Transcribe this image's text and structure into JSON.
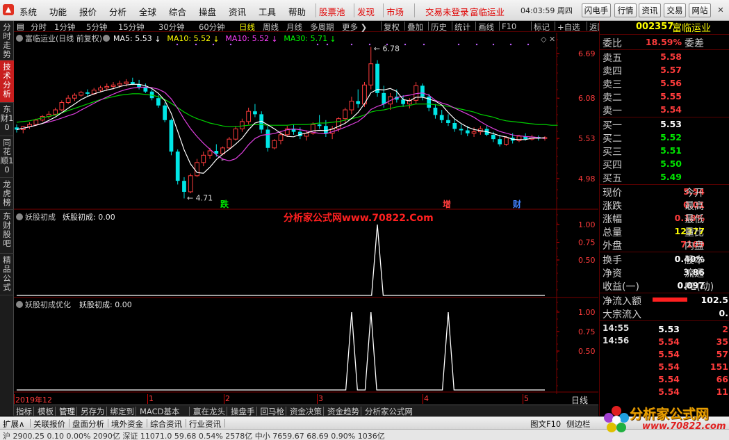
{
  "menu": {
    "items": [
      "系统",
      "功能",
      "报价",
      "分析",
      "全球",
      "综合",
      "操盘",
      "资讯",
      "工具",
      "帮助"
    ],
    "red_items": [
      "股票池",
      "发现",
      "市场"
    ],
    "login": "交易未登录",
    "stock_name": "富临运业",
    "clock": "04:03:59 周四",
    "buttons": [
      "闪电手",
      "行情",
      "资讯",
      "交易",
      "网站"
    ],
    "window_controls": [
      "–",
      "□",
      "×"
    ]
  },
  "left_tabs": [
    {
      "label": "分时走势",
      "active": false
    },
    {
      "label": "技术分析",
      "active": true
    },
    {
      "label": "东财10",
      "active": false
    },
    {
      "label": "同花顺10",
      "active": false
    },
    {
      "label": "龙虎榜",
      "active": false
    },
    {
      "label": "东财股吧",
      "active": false
    },
    {
      "label": "精品公式",
      "active": false
    }
  ],
  "periods": {
    "items": [
      "分时",
      "1分钟",
      "5分钟",
      "15分钟",
      "30分钟",
      "60分钟",
      "日线",
      "周线",
      "月线",
      "多周期",
      "更多"
    ],
    "active": "日线",
    "tools": [
      "复权",
      "叠加",
      "历史",
      "统计",
      "画线",
      "F10",
      "标记",
      "+自选",
      "返回"
    ]
  },
  "main_chart": {
    "title": "富临运业(日线 前复权)",
    "ma": [
      {
        "label": "MA5: 5.53",
        "color": "#ffffff"
      },
      {
        "label": "MA10: 5.52",
        "color": "#ffff00"
      },
      {
        "label": "MA10: 5.52",
        "color": "#ff40ff"
      },
      {
        "label": "MA30: 5.71",
        "color": "#00ff00"
      }
    ],
    "high_label": "6.78",
    "low_label": "4.71",
    "bar_markers": [
      "跌",
      "增",
      "财"
    ],
    "watermark": "分析家公式网www.70822.Com"
  },
  "indicator1": {
    "title": "妖股初成",
    "value_label": "妖股初成: 0.00"
  },
  "indicator2": {
    "title": "妖股初成优化",
    "value_label": "妖股初成: 0.00"
  },
  "x_axis": {
    "labels": [
      "2019年12",
      "1",
      "2",
      "3",
      "4",
      "5"
    ],
    "right_label": "日线"
  },
  "chart_data": [
    {
      "type": "candlestick",
      "title": "富临运业(日线 前复权)",
      "y_ticks": [
        6.69,
        6.08,
        5.53,
        4.98
      ],
      "ylim": [
        4.7,
        6.8
      ],
      "annotations": [
        {
          "text": "6.78",
          "value": 6.78
        },
        {
          "text": "4.71",
          "value": 4.71
        }
      ],
      "candles": [
        {
          "o": 5.68,
          "h": 5.72,
          "l": 5.61,
          "c": 5.65
        },
        {
          "o": 5.65,
          "h": 5.7,
          "l": 5.6,
          "c": 5.69
        },
        {
          "o": 5.69,
          "h": 5.75,
          "l": 5.66,
          "c": 5.72
        },
        {
          "o": 5.72,
          "h": 5.8,
          "l": 5.7,
          "c": 5.78
        },
        {
          "o": 5.78,
          "h": 5.85,
          "l": 5.76,
          "c": 5.83
        },
        {
          "o": 5.83,
          "h": 5.9,
          "l": 5.8,
          "c": 5.86
        },
        {
          "o": 5.86,
          "h": 5.95,
          "l": 5.84,
          "c": 5.92
        },
        {
          "o": 5.92,
          "h": 6.05,
          "l": 5.9,
          "c": 6.02
        },
        {
          "o": 6.02,
          "h": 6.12,
          "l": 6.0,
          "c": 6.08
        },
        {
          "o": 6.08,
          "h": 6.15,
          "l": 6.04,
          "c": 6.12
        },
        {
          "o": 6.12,
          "h": 6.18,
          "l": 6.1,
          "c": 6.16
        },
        {
          "o": 6.16,
          "h": 6.2,
          "l": 6.11,
          "c": 6.14
        },
        {
          "o": 6.14,
          "h": 6.22,
          "l": 6.12,
          "c": 6.19
        },
        {
          "o": 6.19,
          "h": 6.25,
          "l": 6.16,
          "c": 6.22
        },
        {
          "o": 6.22,
          "h": 6.28,
          "l": 6.18,
          "c": 6.24
        },
        {
          "o": 6.24,
          "h": 6.3,
          "l": 6.2,
          "c": 6.26
        },
        {
          "o": 6.26,
          "h": 6.32,
          "l": 6.22,
          "c": 6.28
        },
        {
          "o": 6.28,
          "h": 6.34,
          "l": 6.24,
          "c": 6.3
        },
        {
          "o": 6.3,
          "h": 6.36,
          "l": 6.26,
          "c": 6.27
        },
        {
          "o": 6.27,
          "h": 6.33,
          "l": 6.2,
          "c": 6.23
        },
        {
          "o": 6.23,
          "h": 6.28,
          "l": 6.15,
          "c": 6.17
        },
        {
          "o": 6.17,
          "h": 6.2,
          "l": 6.05,
          "c": 6.08
        },
        {
          "o": 6.08,
          "h": 6.12,
          "l": 5.95,
          "c": 5.98
        },
        {
          "o": 5.98,
          "h": 6.02,
          "l": 5.75,
          "c": 5.78
        },
        {
          "o": 5.78,
          "h": 5.8,
          "l": 5.3,
          "c": 5.35
        },
        {
          "o": 5.35,
          "h": 5.38,
          "l": 4.9,
          "c": 4.95
        },
        {
          "o": 4.95,
          "h": 5.0,
          "l": 4.71,
          "c": 4.8
        },
        {
          "o": 4.8,
          "h": 5.05,
          "l": 4.78,
          "c": 5.02
        },
        {
          "o": 5.02,
          "h": 5.25,
          "l": 5.0,
          "c": 5.2
        },
        {
          "o": 5.2,
          "h": 5.35,
          "l": 5.15,
          "c": 5.3
        },
        {
          "o": 5.3,
          "h": 5.4,
          "l": 5.25,
          "c": 5.36
        },
        {
          "o": 5.36,
          "h": 5.45,
          "l": 5.28,
          "c": 5.32
        },
        {
          "o": 5.32,
          "h": 5.42,
          "l": 5.3,
          "c": 5.4
        },
        {
          "o": 5.4,
          "h": 5.55,
          "l": 5.38,
          "c": 5.52
        },
        {
          "o": 5.52,
          "h": 5.7,
          "l": 5.5,
          "c": 5.66
        },
        {
          "o": 5.66,
          "h": 5.8,
          "l": 5.62,
          "c": 5.76
        },
        {
          "o": 5.76,
          "h": 5.95,
          "l": 5.72,
          "c": 5.9
        },
        {
          "o": 5.9,
          "h": 6.0,
          "l": 5.82,
          "c": 5.86
        },
        {
          "o": 5.86,
          "h": 5.9,
          "l": 5.6,
          "c": 5.65
        },
        {
          "o": 5.65,
          "h": 5.7,
          "l": 5.35,
          "c": 5.4
        },
        {
          "o": 5.4,
          "h": 5.52,
          "l": 5.38,
          "c": 5.5
        },
        {
          "o": 5.5,
          "h": 5.62,
          "l": 5.45,
          "c": 5.58
        },
        {
          "o": 5.58,
          "h": 5.7,
          "l": 5.55,
          "c": 5.66
        },
        {
          "o": 5.66,
          "h": 5.72,
          "l": 5.58,
          "c": 5.62
        },
        {
          "o": 5.62,
          "h": 5.68,
          "l": 5.52,
          "c": 5.56
        },
        {
          "o": 5.56,
          "h": 5.64,
          "l": 5.5,
          "c": 5.6
        },
        {
          "o": 5.6,
          "h": 5.75,
          "l": 5.58,
          "c": 5.72
        },
        {
          "o": 5.72,
          "h": 5.85,
          "l": 5.66,
          "c": 5.7
        },
        {
          "o": 5.7,
          "h": 5.78,
          "l": 5.55,
          "c": 5.6
        },
        {
          "o": 5.6,
          "h": 5.7,
          "l": 5.52,
          "c": 5.66
        },
        {
          "o": 5.66,
          "h": 5.82,
          "l": 5.62,
          "c": 5.8
        },
        {
          "o": 5.8,
          "h": 5.95,
          "l": 5.74,
          "c": 5.92
        },
        {
          "o": 5.92,
          "h": 6.1,
          "l": 5.86,
          "c": 6.04
        },
        {
          "o": 6.04,
          "h": 6.2,
          "l": 5.95,
          "c": 6.0
        },
        {
          "o": 6.0,
          "h": 6.3,
          "l": 5.96,
          "c": 6.26
        },
        {
          "o": 6.26,
          "h": 6.78,
          "l": 6.2,
          "c": 6.55
        },
        {
          "o": 6.55,
          "h": 6.6,
          "l": 6.1,
          "c": 6.15
        },
        {
          "o": 6.15,
          "h": 6.25,
          "l": 5.95,
          "c": 6.0
        },
        {
          "o": 6.0,
          "h": 6.15,
          "l": 5.92,
          "c": 6.1
        },
        {
          "o": 6.1,
          "h": 6.2,
          "l": 6.02,
          "c": 6.06
        },
        {
          "o": 6.06,
          "h": 6.12,
          "l": 5.96,
          "c": 6.0
        },
        {
          "o": 6.0,
          "h": 6.08,
          "l": 5.94,
          "c": 6.05
        },
        {
          "o": 6.05,
          "h": 6.3,
          "l": 6.0,
          "c": 6.25
        },
        {
          "o": 6.25,
          "h": 6.28,
          "l": 6.05,
          "c": 6.1
        },
        {
          "o": 6.1,
          "h": 6.14,
          "l": 5.9,
          "c": 5.95
        },
        {
          "o": 5.95,
          "h": 6.0,
          "l": 5.8,
          "c": 5.85
        },
        {
          "o": 5.85,
          "h": 5.92,
          "l": 5.74,
          "c": 5.78
        },
        {
          "o": 5.78,
          "h": 5.86,
          "l": 5.7,
          "c": 5.74
        },
        {
          "o": 5.74,
          "h": 5.8,
          "l": 5.62,
          "c": 5.66
        },
        {
          "o": 5.66,
          "h": 5.72,
          "l": 5.58,
          "c": 5.64
        },
        {
          "o": 5.64,
          "h": 5.7,
          "l": 5.56,
          "c": 5.6
        },
        {
          "o": 5.6,
          "h": 5.68,
          "l": 5.55,
          "c": 5.62
        },
        {
          "o": 5.62,
          "h": 5.7,
          "l": 5.58,
          "c": 5.66
        },
        {
          "o": 5.66,
          "h": 5.7,
          "l": 5.56,
          "c": 5.58
        },
        {
          "o": 5.58,
          "h": 5.62,
          "l": 5.48,
          "c": 5.52
        },
        {
          "o": 5.52,
          "h": 5.58,
          "l": 5.42,
          "c": 5.45
        },
        {
          "o": 5.45,
          "h": 5.56,
          "l": 5.43,
          "c": 5.54
        },
        {
          "o": 5.54,
          "h": 5.6,
          "l": 5.46,
          "c": 5.5
        },
        {
          "o": 5.5,
          "h": 5.58,
          "l": 5.48,
          "c": 5.56
        },
        {
          "o": 5.56,
          "h": 5.6,
          "l": 5.5,
          "c": 5.52
        },
        {
          "o": 5.52,
          "h": 5.58,
          "l": 5.5,
          "c": 5.55
        },
        {
          "o": 5.55,
          "h": 5.57,
          "l": 5.5,
          "c": 5.53
        },
        {
          "o": 5.53,
          "h": 5.56,
          "l": 5.5,
          "c": 5.54
        }
      ],
      "ma30": [
        5.75,
        5.76,
        5.77,
        5.79,
        5.81,
        5.83,
        5.85,
        5.88,
        5.91,
        5.94,
        5.97,
        6.0,
        6.03,
        6.06,
        6.08,
        6.1,
        6.12,
        6.13,
        6.14,
        6.14,
        6.13,
        6.12,
        6.1,
        6.06,
        6.01,
        5.95,
        5.89,
        5.84,
        5.8,
        5.77,
        5.74,
        5.72,
        5.7,
        5.69,
        5.69,
        5.7,
        5.71,
        5.72,
        5.72,
        5.71,
        5.71,
        5.71,
        5.71,
        5.72,
        5.72,
        5.72,
        5.73,
        5.74,
        5.74,
        5.75,
        5.76,
        5.78,
        5.8,
        5.82,
        5.85,
        5.89,
        5.91,
        5.92,
        5.94,
        5.96,
        5.97,
        5.98,
        6.0,
        6.0,
        6.0,
        5.99,
        5.98,
        5.97,
        5.95,
        5.93,
        5.91,
        5.89,
        5.86,
        5.84,
        5.82,
        5.79,
        5.77,
        5.76,
        5.75,
        5.74,
        5.73,
        5.72,
        5.72,
        5.71,
        5.71
      ]
    },
    {
      "type": "line",
      "title": "妖股初成",
      "y_ticks": [
        1.0,
        0.75,
        0.5
      ],
      "ylim": [
        0,
        1.0
      ],
      "spikes_at": [
        56
      ]
    },
    {
      "type": "line",
      "title": "妖股初成优化",
      "y_ticks": [
        1.0,
        0.75,
        0.5
      ],
      "ylim": [
        0,
        1.0
      ],
      "spikes_at": [
        52,
        55,
        67
      ]
    }
  ],
  "right_panel": {
    "code": "002357",
    "name": "富临运业",
    "webi": {
      "label": "委比",
      "value": "18.59%",
      "label2": "委差"
    },
    "asks": [
      {
        "label": "卖五",
        "price": "5.58"
      },
      {
        "label": "卖四",
        "price": "5.57"
      },
      {
        "label": "卖三",
        "price": "5.56"
      },
      {
        "label": "卖二",
        "price": "5.55"
      },
      {
        "label": "卖一",
        "price": "5.54"
      }
    ],
    "bids": [
      {
        "label": "买一",
        "price": "5.53",
        "color": "white"
      },
      {
        "label": "买二",
        "price": "5.52",
        "color": "green"
      },
      {
        "label": "买三",
        "price": "5.51",
        "color": "green"
      },
      {
        "label": "买四",
        "price": "5.50",
        "color": "green"
      },
      {
        "label": "买五",
        "price": "5.49",
        "color": "green"
      }
    ],
    "stats": [
      {
        "l1": "现价",
        "v": "5.54",
        "c": "red",
        "l2": "今开"
      },
      {
        "l1": "涨跌",
        "v": "0.01",
        "c": "red",
        "l2": "最高"
      },
      {
        "l1": "涨幅",
        "v": "0.18%",
        "c": "red",
        "l2": "最低"
      },
      {
        "l1": "总量",
        "v": "12377",
        "c": "yellow",
        "l2": "量比"
      },
      {
        "l1": "外盘",
        "v": "7109",
        "c": "red",
        "l2": "内盘"
      }
    ],
    "stats2": [
      {
        "l1": "换手",
        "v": "0.40%",
        "c": "white",
        "l2": "股本"
      },
      {
        "l1": "净资",
        "v": "3.86",
        "c": "white",
        "l2": "流通"
      },
      {
        "l1": "收益(一)",
        "v": "0.097",
        "c": "white",
        "l2": "PE(动)"
      }
    ],
    "flow": [
      {
        "label": "净流入额",
        "value": "102.5",
        "bar_fraction": 1.0
      },
      {
        "label": "大宗流入",
        "value": "0.",
        "bar_fraction": 0
      }
    ],
    "ticks": [
      {
        "time": "14:55",
        "price": "5.53",
        "pc": "white",
        "vol": "2"
      },
      {
        "time": "14:56",
        "price": "5.54",
        "pc": "red",
        "vol": "35"
      },
      {
        "time": "",
        "price": "5.54",
        "pc": "red",
        "vol": "57"
      },
      {
        "time": "",
        "price": "5.54",
        "pc": "red",
        "vol": "151"
      },
      {
        "time": "",
        "price": "5.54",
        "pc": "red",
        "vol": "66"
      },
      {
        "time": "",
        "price": "5.54",
        "pc": "red",
        "vol": "11"
      }
    ]
  },
  "indicator_tabs": {
    "items": [
      "指标",
      "模板",
      "管理",
      "另存为",
      "绑定到",
      "MACD基本",
      "赢在龙头",
      "操盘手",
      "回马枪",
      "资金决策",
      "资金趋势",
      "分析家公式网"
    ],
    "active": "管理"
  },
  "bottom_tabs": [
    "扩展∧",
    "关联报价",
    "盘面分析",
    "境外资金",
    "综合资讯",
    "行业资讯"
  ],
  "bottom_right": [
    "图文F10",
    "侧边栏"
  ],
  "status_text": "沪 2900.25  0.10  0.00%  2090亿    深证 11071.0  59.68  0.54%  2578亿    中小 7659.67  68.69  0.90%  1036亿",
  "watermark_logo": {
    "name": "分析家公式网",
    "url": "www.70822.com"
  }
}
